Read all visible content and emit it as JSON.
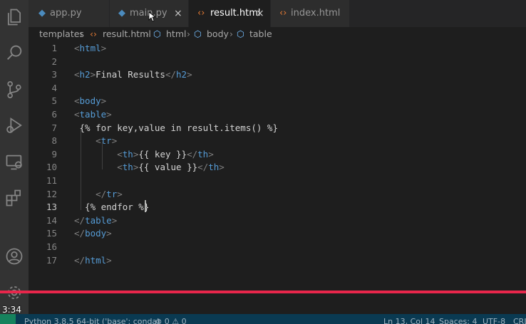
{
  "tabs": [
    {
      "label": "app.py",
      "icon": "python-icon",
      "active": false
    },
    {
      "label": "main.py",
      "icon": "python-icon",
      "active": false
    },
    {
      "label": "result.html",
      "icon": "html-icon",
      "active": true,
      "close": "×"
    },
    {
      "label": "index.html",
      "icon": "html-icon",
      "active": false
    }
  ],
  "breadcrumb": [
    "templates",
    "result.html",
    "html",
    "body",
    "table"
  ],
  "editor": {
    "current_line": 13,
    "lines": [
      {
        "num": "1",
        "text": "<html>"
      },
      {
        "num": "2",
        "text": ""
      },
      {
        "num": "3",
        "text": "<h2>Final Results</h2>"
      },
      {
        "num": "4",
        "text": ""
      },
      {
        "num": "5",
        "text": "<body>"
      },
      {
        "num": "6",
        "text": "<table>"
      },
      {
        "num": "7",
        "text": " {% for key,value in result.items() %}"
      },
      {
        "num": "8",
        "text": "    <tr>"
      },
      {
        "num": "9",
        "text": "        <th>{{ key }}</th>"
      },
      {
        "num": "10",
        "text": "        <th>{{ value }}</th>"
      },
      {
        "num": "11",
        "text": ""
      },
      {
        "num": "12",
        "text": "    </tr>"
      },
      {
        "num": "13",
        "text": "  {% endfor %}"
      },
      {
        "num": "14",
        "text": "</table>"
      },
      {
        "num": "15",
        "text": "</body>"
      },
      {
        "num": "16",
        "text": ""
      },
      {
        "num": "17",
        "text": "</html>"
      }
    ]
  },
  "video": {
    "time": "3:34",
    "progress": 1.0
  },
  "statusbar": {
    "interpreter": "Python 3.8.5 64-bit ('base': conda)",
    "problems": "⊗ 0 ⚠ 0",
    "position": "Ln 13, Col 14",
    "spaces": "Spaces: 4",
    "encoding": "UTF-8",
    "eol": "CRL"
  },
  "colors": {
    "accent": "#e8264b",
    "status_bg": "#0a3a52",
    "tag": "#569cd6"
  }
}
